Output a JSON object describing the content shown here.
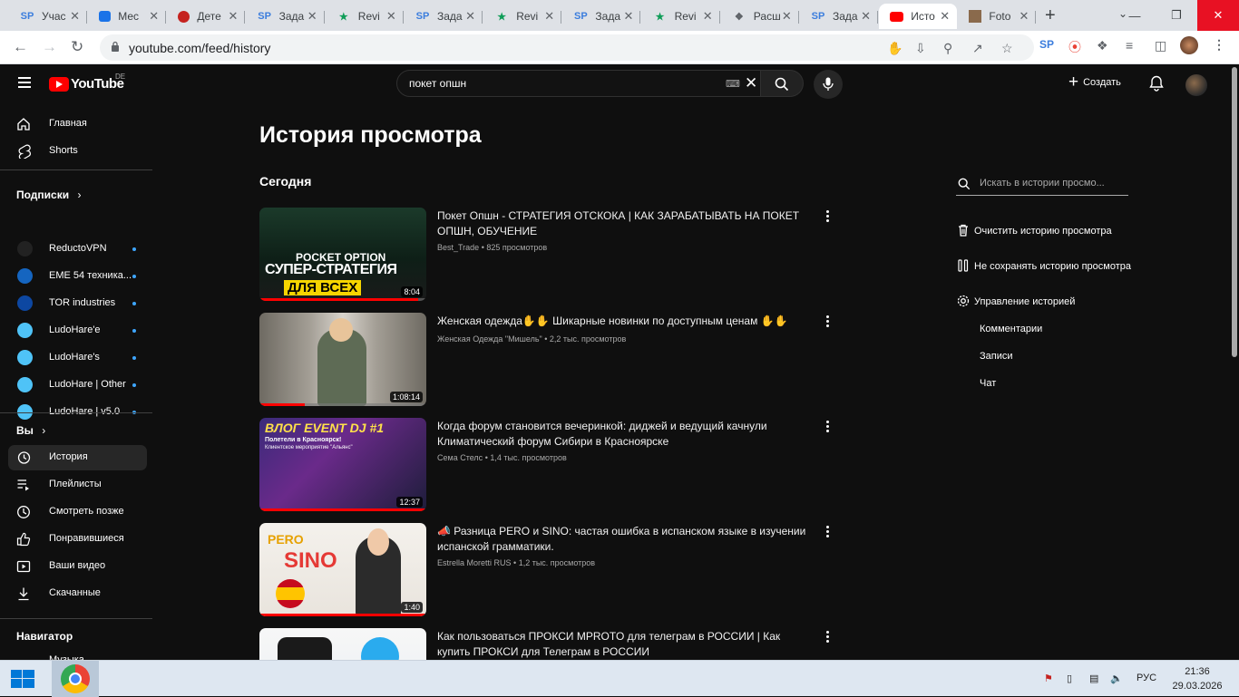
{
  "browser": {
    "tabs": [
      {
        "label": "Учас",
        "favicon": "SP",
        "favicon_color": "#3b7ddd",
        "active": false
      },
      {
        "label": "Мес",
        "favicon": "msg",
        "favicon_color": "#1a73e8",
        "active": false
      },
      {
        "label": "Дете",
        "favicon": "circle",
        "favicon_color": "#c5221f",
        "active": false
      },
      {
        "label": "Зада",
        "favicon": "SP",
        "favicon_color": "#3b7ddd",
        "active": false
      },
      {
        "label": "Revi",
        "favicon": "star",
        "favicon_color": "#0f9d58",
        "active": false
      },
      {
        "label": "Зада",
        "favicon": "SP",
        "favicon_color": "#3b7ddd",
        "active": false
      },
      {
        "label": "Revi",
        "favicon": "star",
        "favicon_color": "#0f9d58",
        "active": false
      },
      {
        "label": "Зада",
        "favicon": "SP",
        "favicon_color": "#3b7ddd",
        "active": false
      },
      {
        "label": "Revi",
        "favicon": "star",
        "favicon_color": "#0f9d58",
        "active": false
      },
      {
        "label": "Расш",
        "favicon": "puzzle",
        "favicon_color": "#5f6368",
        "active": false
      },
      {
        "label": "Зада",
        "favicon": "SP",
        "favicon_color": "#3b7ddd",
        "active": false
      },
      {
        "label": "Исто",
        "favicon": "yt",
        "favicon_color": "#ff0000",
        "active": true
      },
      {
        "label": "Foto",
        "favicon": "photo",
        "favicon_color": "#8a6a4c",
        "active": false
      }
    ],
    "url": "youtube.com/feed/history"
  },
  "youtube": {
    "logo_text": "YouTube",
    "region": "DE",
    "search_query": "покет опшн",
    "create_label": "Создать"
  },
  "sidebar": {
    "main": [
      {
        "label": "Главная",
        "icon": "home-icon"
      },
      {
        "label": "Shorts",
        "icon": "shorts-icon"
      }
    ],
    "subs_title": "Подписки",
    "subscriptions": [
      {
        "label": "ReductoVPN",
        "color": "#222222"
      },
      {
        "label": "EME 54 техника...",
        "color": "#1565c0"
      },
      {
        "label": "TOR industries",
        "color": "#0d47a1"
      },
      {
        "label": "LudoHare'e",
        "color": "#4fc3f7"
      },
      {
        "label": "LudoHare's",
        "color": "#4fc3f7"
      },
      {
        "label": "LudoHare | Other",
        "color": "#4fc3f7"
      },
      {
        "label": "LudoHare | v5.0",
        "color": "#4fc3f7"
      }
    ],
    "you_title": "Вы",
    "you": [
      {
        "label": "История",
        "icon": "history-icon",
        "active": true
      },
      {
        "label": "Плейлисты",
        "icon": "playlists-icon"
      },
      {
        "label": "Смотреть позже",
        "icon": "watch-later-icon"
      },
      {
        "label": "Понравившиеся",
        "icon": "like-icon"
      },
      {
        "label": "Ваши видео",
        "icon": "your-videos-icon"
      },
      {
        "label": "Скачанные",
        "icon": "download-icon"
      }
    ],
    "nav_title": "Навигатор",
    "nav_partial": "Музыка"
  },
  "main": {
    "page_title": "История просмотра",
    "day_heading": "Сегодня",
    "videos": [
      {
        "title": "Покет Опшн - СТРАТЕГИЯ ОТСКОКА | КАК ЗАРАБАТЫВАТЬ НА ПОКЕТ ОПШН, ОБУЧЕНИЕ",
        "channel": "Best_Trade",
        "views": "825 просмотров",
        "duration": "8:04",
        "progress": 0.95,
        "thumb_text": "СУПЕР-СТРАТЕГИЯ",
        "thumb_text2": "ДЛЯ ВСЕХ",
        "thumb_text3": "POCKET OPTION"
      },
      {
        "title": "Женская одежда✋✋ Шикарные новинки по доступным ценам ✋✋",
        "channel": "Женская Одежда \"Мишель\"",
        "views": "2,2 тыс. просмотров",
        "duration": "1:08:14",
        "progress": 0.27
      },
      {
        "title": "Когда форум становится вечеринкой: диджей и ведущий качнули Климатический форум Сибири в Красноярске",
        "channel": "Сема Стелс",
        "views": "1,4 тыс. просмотров",
        "duration": "12:37",
        "progress": 1.0,
        "thumb_text": "ВЛОГ EVENT DJ #1",
        "thumb_text2": "Полетели в Красноярск!",
        "thumb_text3": "Клиентское мероприятие \"Альянс\""
      },
      {
        "title": "📣 Разница PERO и SINO: частая ошибка в испанском языке в изучении испанской грамматики.",
        "channel": "Estrella Moretti RUS",
        "views": "1,2 тыс. просмотров",
        "duration": "1:40",
        "progress": 1.0,
        "thumb_text": "PERO",
        "thumb_text2": "SINO"
      },
      {
        "title": "Как пользоваться ПРОКСИ MPROTO для телеграм в РОССИИ | Как купить ПРОКСИ для Телеграм в РОССИИ",
        "channel": "",
        "views": "",
        "duration": "",
        "progress": 0
      }
    ],
    "history_search_placeholder": "Искать в истории просмо...",
    "actions": [
      {
        "label": "Очистить историю просмотра",
        "icon": "trash-icon"
      },
      {
        "label": "Не сохранять историю просмотра",
        "icon": "pause-icon"
      },
      {
        "label": "Управление историей",
        "icon": "gear-icon"
      }
    ],
    "sub_links": [
      "Комментарии",
      "Записи",
      "Чат"
    ]
  },
  "taskbar": {
    "lang": "РУС",
    "time": "21:36",
    "date": "29.03.2026"
  }
}
